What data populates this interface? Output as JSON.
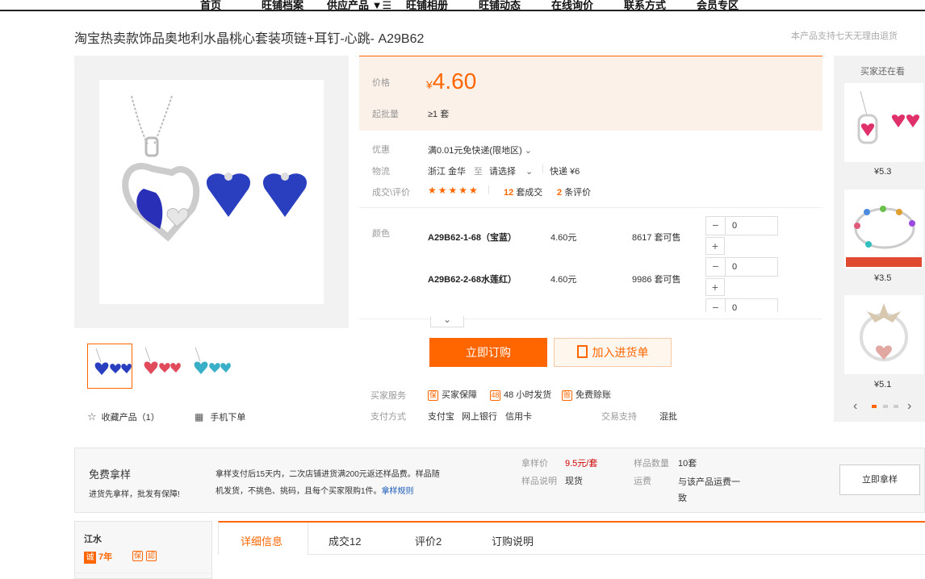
{
  "nav": [
    "首页",
    "旺铺档案",
    "供应产品 ▼☰",
    "旺铺相册",
    "旺铺动态",
    "在线询价",
    "联系方式",
    "会员专区"
  ],
  "product": {
    "title": "淘宝热卖款饰品奥地利水晶桃心套装项链+耳钉-心跳- A29B62",
    "promise": "本产品支持七天无理由退货",
    "price_label": "价格",
    "currency": "¥",
    "price": "4.60",
    "moq_label": "起批量",
    "moq": "≥1 套"
  },
  "info": {
    "promo_label": "优惠",
    "promo": "满0.01元免快递(限地区)",
    "logistics_label": "物流",
    "from": "浙江 金华",
    "to_word": "至",
    "choose": "请选择",
    "express": "快递 ¥6",
    "deals_label": "成交\\评价",
    "stars": "★★★★★",
    "deals_count": "12",
    "deals_text": "套成交",
    "reviews_count": "2",
    "reviews_text": "条评价"
  },
  "sku": {
    "color_label": "颜色",
    "rows": [
      {
        "name": "A29B62-1-68（宝蓝）",
        "price": "4.60元",
        "stock": "8617 套可售",
        "qty": "0"
      },
      {
        "name": "A29B62-2-68水莲红）",
        "price": "4.60元",
        "stock": "9986 套可售",
        "qty": "0"
      },
      {
        "qty": "0"
      }
    ]
  },
  "buttons": {
    "order": "立即订购",
    "cart": "加入进货单",
    "sample": "立即拿样"
  },
  "service": {
    "label": "买家服务",
    "items": [
      "买家保障",
      "48 小时发货",
      "免费赊账"
    ],
    "pay_label": "支付方式",
    "pay": [
      "支付宝",
      "网上银行",
      "信用卡"
    ],
    "trade_label": "交易支持",
    "trade": "混批"
  },
  "gallery": {
    "fav": "收藏产品（1）",
    "mobile": "手机下单"
  },
  "side": {
    "title": "买家还在看",
    "prices": [
      "¥5.3",
      "¥3.5",
      "¥5.1"
    ]
  },
  "sample": {
    "title": "免费拿样",
    "sub": "进货先拿样，批发有保障!",
    "desc1": "拿样支付后15天内，二次店铺进货满200元返还样品费。样品随",
    "desc2": "机发货，不挑色、挑码，且每个买家限购1件。",
    "rule": "拿样规则",
    "price_label": "拿样价",
    "price": "9.5元/套",
    "qty_label": "样品数量",
    "qty": "10套",
    "note_label": "样品说明",
    "note": "现货",
    "ship_label": "运费",
    "ship": "与该产品运费一致"
  },
  "shop": {
    "name": "江水",
    "badge": "诚",
    "years": "7年"
  },
  "tabs": [
    "详细信息",
    "成交12",
    "评价2",
    "订购说明"
  ],
  "colors": {
    "accent": "#ff6600"
  }
}
